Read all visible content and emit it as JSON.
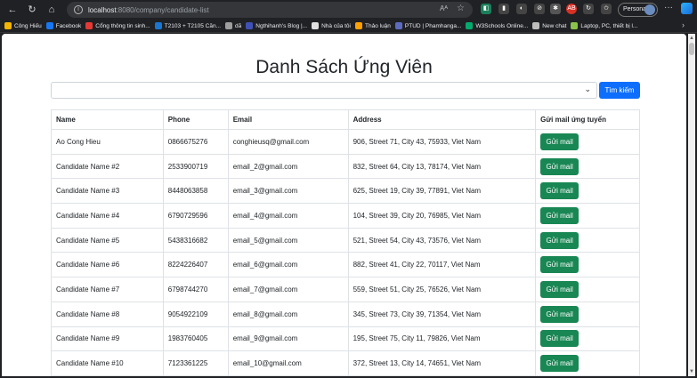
{
  "browser": {
    "url_host": "localhost",
    "url_path": ":8080/company/candidate-list",
    "profile_label": "Personal",
    "bookmarks": [
      {
        "label": "Công Hiếu",
        "color": "#f4b400"
      },
      {
        "label": "Facebook",
        "color": "#1877f2"
      },
      {
        "label": "Cổng thông tin sinh...",
        "color": "#e53935"
      },
      {
        "label": "T2103 + T2105 Căn...",
        "color": "#1976d2"
      },
      {
        "label": "dã",
        "color": "#9e9e9e"
      },
      {
        "label": "Ngthihanh's Blog |...",
        "color": "#3f51b5"
      },
      {
        "label": "Nhà của tôi",
        "color": "#e0e0e0"
      },
      {
        "label": "Thảo luận",
        "color": "#ffa000"
      },
      {
        "label": "PTUD | Phamhanga...",
        "color": "#5c6bc0"
      },
      {
        "label": "W3Schools Online...",
        "color": "#04aa6d"
      },
      {
        "label": "New chat",
        "color": "#bdbdbd"
      },
      {
        "label": "Laptop, PC, thiết bị l...",
        "color": "#8bc34a"
      }
    ]
  },
  "page": {
    "title": "Danh Sách Ứng Viên",
    "search_button": "Tìm kiếm",
    "columns": [
      "Name",
      "Phone",
      "Email",
      "Address",
      "Gửi mail ứng tuyển"
    ],
    "send_button": "Gửi mail",
    "rows": [
      {
        "name": "Ao Cong Hieu",
        "phone": "0866675276",
        "email": "conghieusq@gmail.com",
        "address": "906, Street 71, City 43, 75933, Viet Nam"
      },
      {
        "name": "Candidate Name #2",
        "phone": "2533900719",
        "email": "email_2@gmail.com",
        "address": "832, Street 64, City 13, 78174, Viet Nam"
      },
      {
        "name": "Candidate Name #3",
        "phone": "8448063858",
        "email": "email_3@gmail.com",
        "address": "625, Street 19, City 39, 77891, Viet Nam"
      },
      {
        "name": "Candidate Name #4",
        "phone": "6790729596",
        "email": "email_4@gmail.com",
        "address": "104, Street 39, City 20, 76985, Viet Nam"
      },
      {
        "name": "Candidate Name #5",
        "phone": "5438316682",
        "email": "email_5@gmail.com",
        "address": "521, Street 54, City 43, 73576, Viet Nam"
      },
      {
        "name": "Candidate Name #6",
        "phone": "8224226407",
        "email": "email_6@gmail.com",
        "address": "882, Street 41, City 22, 70117, Viet Nam"
      },
      {
        "name": "Candidate Name #7",
        "phone": "6798744270",
        "email": "email_7@gmail.com",
        "address": "559, Street 51, City 25, 76526, Viet Nam"
      },
      {
        "name": "Candidate Name #8",
        "phone": "9054922109",
        "email": "email_8@gmail.com",
        "address": "345, Street 73, City 39, 71354, Viet Nam"
      },
      {
        "name": "Candidate Name #9",
        "phone": "1983760405",
        "email": "email_9@gmail.com",
        "address": "195, Street 75, City 11, 79826, Viet Nam"
      },
      {
        "name": "Candidate Name #10",
        "phone": "7123361225",
        "email": "email_10@gmail.com",
        "address": "372, Street 13, City 14, 74651, Viet Nam"
      }
    ]
  },
  "colors": {
    "primary": "#0d6efd",
    "success": "#198754"
  }
}
